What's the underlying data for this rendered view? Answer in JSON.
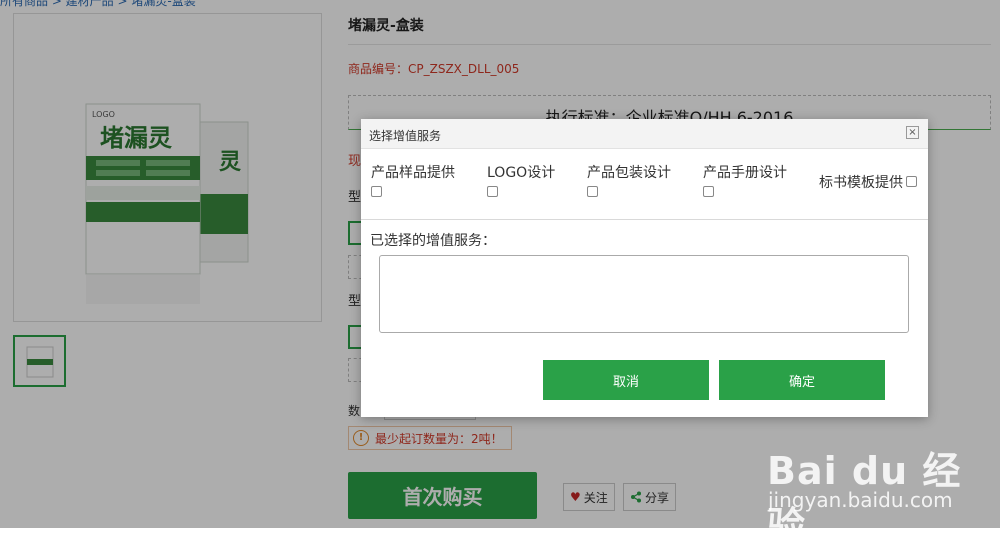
{
  "breadcrumb": {
    "text": "所有商品 > 建材产品 > 堵漏灵-盒装"
  },
  "product": {
    "title": "堵漏灵-盒装",
    "sku": "商品编号：CP_ZSZX_DLL_005",
    "standard": "执行标准：企业标准Q/HH 6-2016",
    "image_logo": "LOGO",
    "image_name": "堵漏灵",
    "side_labels": [
      "现",
      "型",
      "型"
    ],
    "qty_label": "数",
    "min_order": "最少起订数量为：2吨！",
    "buy_label": "首次购买",
    "follow_label": "关注",
    "share_label": "分享"
  },
  "modal": {
    "title": "选择增值服务",
    "close": "×",
    "services": [
      "产品样品提供",
      "LOGO设计",
      "产品包装设计",
      "产品手册设计",
      "标书模板提供"
    ],
    "selected_label": "已选择的增值服务：",
    "selected_value": "",
    "cancel_label": "取消",
    "confirm_label": "确定"
  },
  "watermark": {
    "main": "Bai du 经验",
    "sub": "jingyan.baidu.com"
  },
  "colors": {
    "accent": "#2aa148",
    "price_red": "#d23a2a",
    "link": "#2b6ab3"
  }
}
